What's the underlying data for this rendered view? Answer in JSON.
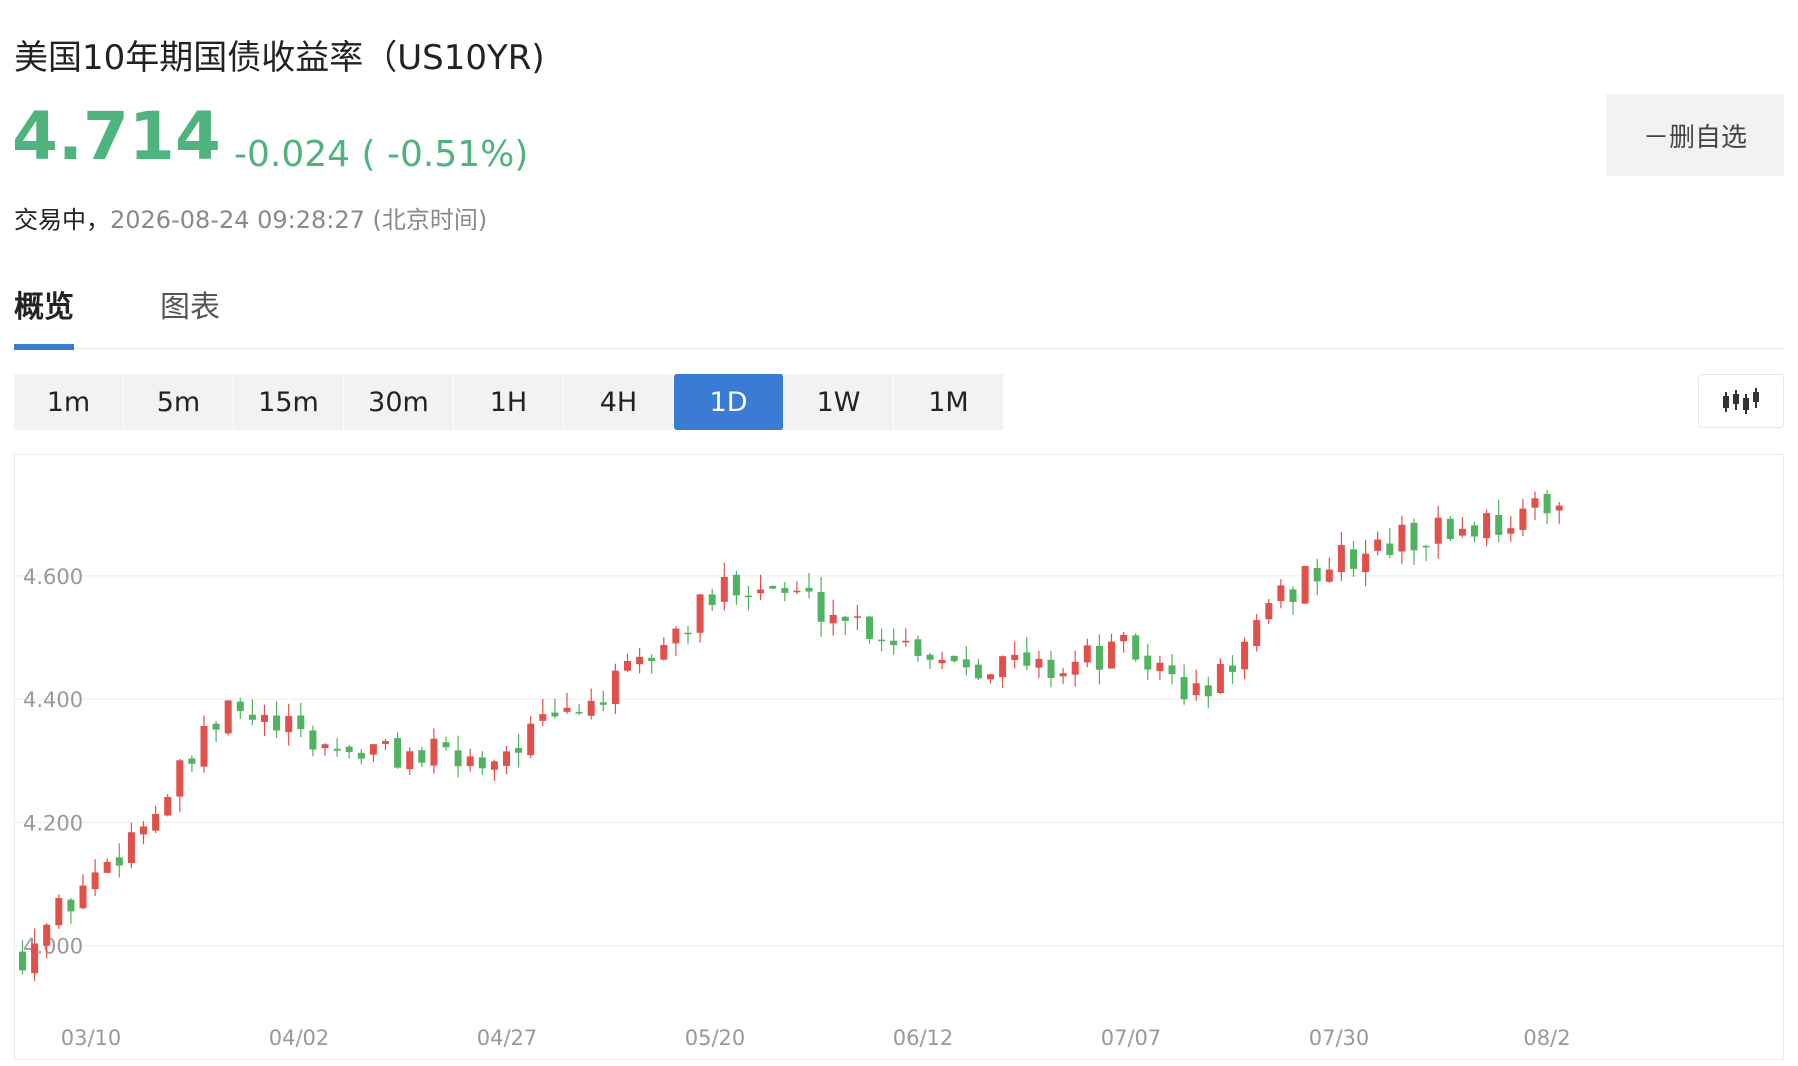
{
  "header": {
    "title": "美国10年期国债收益率（US10YR)",
    "price": "4.714",
    "change": "-0.024 ( -0.51%)",
    "status": "交易中，",
    "timestamp": "2026-08-24 09:28:27 (北京时间)"
  },
  "watchlist": {
    "remove_label": "－删自选"
  },
  "tabs": [
    {
      "label": "概览",
      "active": true
    },
    {
      "label": "图表",
      "active": false
    }
  ],
  "periods": [
    {
      "label": "1m",
      "active": false
    },
    {
      "label": "5m",
      "active": false
    },
    {
      "label": "15m",
      "active": false
    },
    {
      "label": "30m",
      "active": false
    },
    {
      "label": "1H",
      "active": false
    },
    {
      "label": "4H",
      "active": false
    },
    {
      "label": "1D",
      "active": true
    },
    {
      "label": "1W",
      "active": false
    },
    {
      "label": "1M",
      "active": false
    }
  ],
  "chart_type_icon": "candlestick-icon",
  "colors": {
    "up": "#e2504c",
    "down": "#4fb35f",
    "accent": "#3a7bd5",
    "price": "#4fb37d"
  },
  "chart_data": {
    "type": "candlestick",
    "y_ticks": [
      "4.000",
      "4.200",
      "4.400",
      "4.600"
    ],
    "x_ticks": [
      "03/10",
      "04/02",
      "04/27",
      "05/20",
      "06/12",
      "07/07",
      "07/30",
      "08/2"
    ],
    "ylim": [
      3.92,
      4.78
    ],
    "grid": true,
    "close_start": 3.99,
    "candles_count": 128,
    "close_end": 4.714
  }
}
